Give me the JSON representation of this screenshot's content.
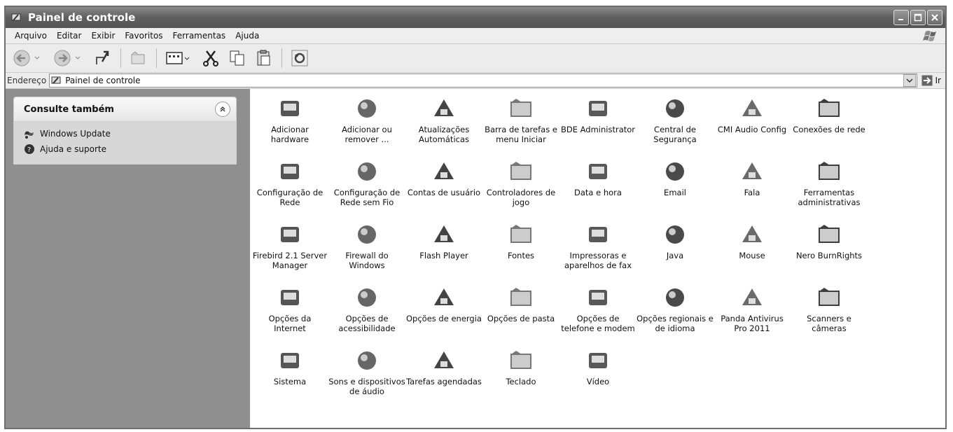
{
  "window": {
    "title": "Painel de controle"
  },
  "menu": [
    "Arquivo",
    "Editar",
    "Exibir",
    "Favoritos",
    "Ferramentas",
    "Ajuda"
  ],
  "address": {
    "label": "Endereço",
    "value": "Painel de controle",
    "go_label": "Ir"
  },
  "sidebar": {
    "heading": "Consulte também",
    "links": [
      {
        "label": "Windows Update",
        "icon": "windows-update-icon"
      },
      {
        "label": "Ajuda e suporte",
        "icon": "help-icon"
      }
    ]
  },
  "items": [
    {
      "label": "Adicionar hardware",
      "icon": "hardware-icon"
    },
    {
      "label": "Adicionar ou remover ...",
      "icon": "add-remove-programs-icon"
    },
    {
      "label": "Atualizações Automáticas",
      "icon": "automatic-updates-icon"
    },
    {
      "label": "Barra de tarefas e menu Iniciar",
      "icon": "taskbar-icon"
    },
    {
      "label": "BDE Administrator",
      "icon": "bde-admin-icon"
    },
    {
      "label": "Central de Segurança",
      "icon": "security-shield-icon"
    },
    {
      "label": "CMI Audio Config",
      "icon": "xear-3d-icon"
    },
    {
      "label": "Conexões de rede",
      "icon": "network-connections-icon"
    },
    {
      "label": "Configuração de Rede",
      "icon": "network-setup-icon"
    },
    {
      "label": "Configuração de Rede sem Fio",
      "icon": "wireless-icon"
    },
    {
      "label": "Contas de usuário",
      "icon": "user-accounts-icon"
    },
    {
      "label": "Controladores de jogo",
      "icon": "game-controller-icon"
    },
    {
      "label": "Data e hora",
      "icon": "date-time-icon"
    },
    {
      "label": "Email",
      "icon": "email-icon"
    },
    {
      "label": "Fala",
      "icon": "speech-icon"
    },
    {
      "label": "Ferramentas administrativas",
      "icon": "admin-tools-icon"
    },
    {
      "label": "Firebird 2.1 Server Manager",
      "icon": "firebird-icon"
    },
    {
      "label": "Firewall do Windows",
      "icon": "firewall-icon"
    },
    {
      "label": "Flash Player",
      "icon": "flash-icon"
    },
    {
      "label": "Fontes",
      "icon": "fonts-folder-icon"
    },
    {
      "label": "Impressoras e aparelhos de fax",
      "icon": "printer-icon"
    },
    {
      "label": "Java",
      "icon": "java-icon"
    },
    {
      "label": "Mouse",
      "icon": "mouse-icon"
    },
    {
      "label": "Nero BurnRights",
      "icon": "nero-icon"
    },
    {
      "label": "Opções da Internet",
      "icon": "internet-options-icon"
    },
    {
      "label": "Opções de acessibilidade",
      "icon": "accessibility-icon"
    },
    {
      "label": "Opções de energia",
      "icon": "power-icon"
    },
    {
      "label": "Opções de pasta",
      "icon": "folder-options-icon"
    },
    {
      "label": "Opções de telefone e modem",
      "icon": "phone-modem-icon"
    },
    {
      "label": "Opções regionais e de idioma",
      "icon": "globe-icon"
    },
    {
      "label": "Panda Antivirus Pro 2011",
      "icon": "panda-icon"
    },
    {
      "label": "Scanners e câmeras",
      "icon": "scanner-icon"
    },
    {
      "label": "Sistema",
      "icon": "system-icon"
    },
    {
      "label": "Sons e dispositivos de áudio",
      "icon": "speaker-icon"
    },
    {
      "label": "Tarefas agendadas",
      "icon": "scheduled-tasks-icon"
    },
    {
      "label": "Teclado",
      "icon": "keyboard-icon"
    },
    {
      "label": "Vídeo",
      "icon": "display-icon"
    }
  ]
}
